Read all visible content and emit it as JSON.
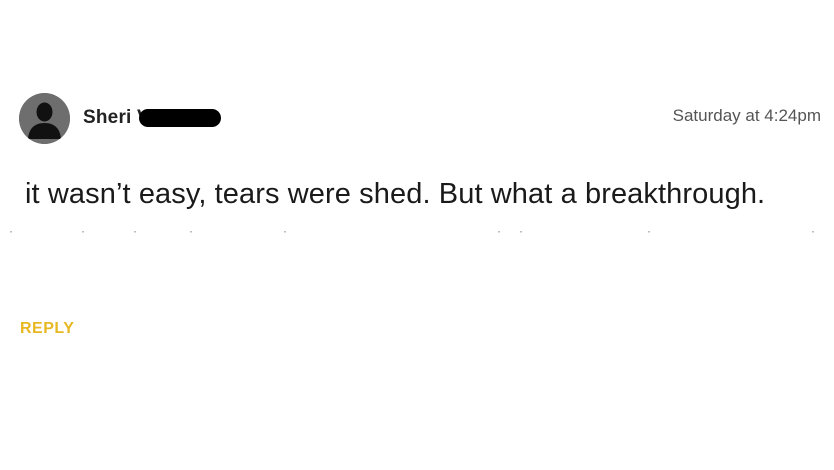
{
  "comment": {
    "author_name": "Sheri V",
    "timestamp": "Saturday at 4:24pm",
    "text": "it wasn’t easy, tears were shed. But what a breakthrough.",
    "reply_label": "REPLY"
  },
  "colors": {
    "accent": "#e8b822",
    "avatar_bg": "#6b6b6b",
    "text": "#1a1a1a",
    "meta_text": "#555555"
  },
  "icons": {
    "avatar": "user-silhouette-icon"
  }
}
